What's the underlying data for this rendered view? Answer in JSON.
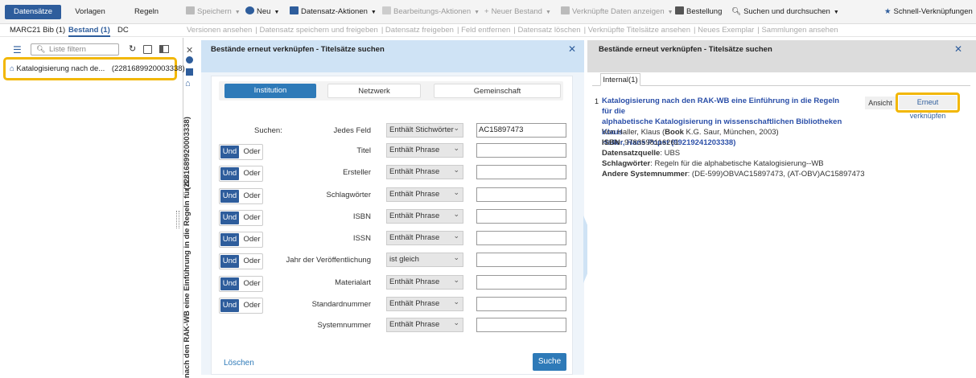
{
  "nav": {
    "tabs": [
      "Datensätze",
      "Vorlagen",
      "Regeln"
    ],
    "toolbar": {
      "save": "Speichern",
      "new": "Neu",
      "record_actions": "Datensatz-Aktionen",
      "edit_actions": "Bearbeitungs-Aktionen",
      "new_holding": "Neuer Bestand",
      "linked_data": "Verknüpfte Daten anzeigen",
      "order": "Bestellung",
      "search": "Suchen und durchsuchen",
      "shortcuts": "Schnell-Verknüpfungen"
    }
  },
  "subtabs": [
    "MARC21 Bib (1)",
    "Bestand (1)",
    "DC"
  ],
  "actions": [
    "Versionen ansehen",
    "Datensatz speichern und freigeben",
    "Datensatz freigeben",
    "Feld entfernen",
    "Datensatz löschen",
    "Verknüpfte Titelsätze ansehen",
    "Neues Exemplar",
    "Sammlungen ansehen"
  ],
  "left": {
    "filter_placeholder": "Liste filtern",
    "record_title": "Katalogisierung nach de...",
    "record_id": "(2281689920003338)"
  },
  "vertical": {
    "id": "(2281689920003338)",
    "title": "nach den RAK-WB eine Einführung in die Regeln für d..."
  },
  "search_panel": {
    "title": "Bestände erneut verknüpfen - Titelsätze suchen",
    "scopes": [
      "Institution",
      "Netzwerk",
      "Gemeinschaft"
    ],
    "search_label": "Suchen:",
    "bool_and": "Und",
    "bool_or": "Oder",
    "rows": [
      {
        "field": "Jedes Feld",
        "op": "Enthält Stichwörter",
        "value": "AC15897473"
      },
      {
        "field": "Titel",
        "op": "Enthält Phrase",
        "value": ""
      },
      {
        "field": "Ersteller",
        "op": "Enthält Phrase",
        "value": ""
      },
      {
        "field": "Schlagwörter",
        "op": "Enthält Phrase",
        "value": ""
      },
      {
        "field": "ISBN",
        "op": "Enthält Phrase",
        "value": ""
      },
      {
        "field": "ISSN",
        "op": "Enthält Phrase",
        "value": ""
      },
      {
        "field": "Jahr der Veröffentlichung",
        "op": "ist gleich",
        "value": ""
      },
      {
        "field": "Materialart",
        "op": "Enthält Phrase",
        "value": ""
      },
      {
        "field": "Standardnummer",
        "op": "Enthält Phrase",
        "value": ""
      },
      {
        "field": "Systemnummer",
        "op": "Enthält Phrase",
        "value": ""
      }
    ],
    "clear": "Löschen",
    "submit": "Suche"
  },
  "results_panel": {
    "title": "Bestände erneut verknüpfen - Titelsätze suchen",
    "tab": "Internal(1)",
    "result": {
      "num": "1",
      "title_l1": "Katalogisierung nach den RAK-WB eine Einführung in die Regeln für die",
      "title_l2": "alphabetische Katalogisierung in wissenschaftlichen Bibliotheken Klaus",
      "title_l3": "Haller, Hans Popst (99219241203338)",
      "author_pre": "Von Haller, Klaus (",
      "author_book": "Book",
      "author_post": " K.G. Saur, München, 2003)",
      "isbn_label": "ISBN",
      "isbn": ": 9783598116261",
      "source_label": "Datensatzquelle",
      "source": ": UBS",
      "subject_label": "Schlagwörter",
      "subject": ": Regeln für die alphabetische Katalogisierung--WB",
      "other_label": "Andere Systemnummer",
      "other": ": (DE-599)OBVAC15897473, (AT-OBV)AC15897473"
    },
    "view_button": "Ansicht",
    "relink_button": "Erneut verknüpfen"
  },
  "colors": {
    "primary": "#2e5d9c",
    "highlight": "#f2b705",
    "link": "#2b4fa8"
  }
}
